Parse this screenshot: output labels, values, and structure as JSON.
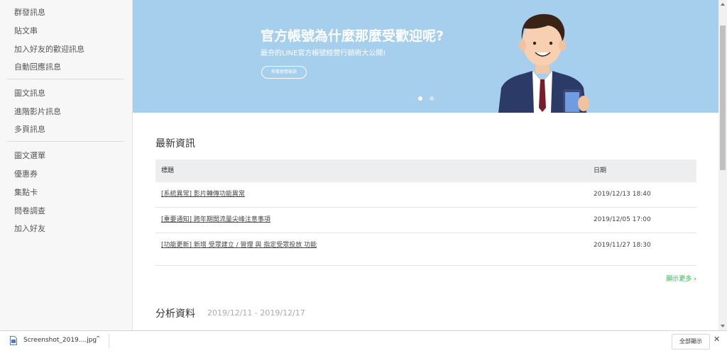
{
  "sidebar": {
    "group1": [
      "群發訊息",
      "貼文串",
      "加入好友的歡迎訊息",
      "自動回應訊息"
    ],
    "group2": [
      "圖文訊息",
      "進階影片訊息",
      "多頁訊息"
    ],
    "group3": [
      "圖文選單",
      "優惠券",
      "集點卡",
      "問卷調查",
      "加入好友"
    ]
  },
  "banner": {
    "title": "官方帳號為什麼那麼受歡迎呢?",
    "subtitle": "最夯的LINE官方帳號經營行銷術大公開!",
    "button_label": "來看經營秘訣",
    "active_dot_color": "#ffffff",
    "dot_color": "#cfe4f4"
  },
  "news": {
    "title": "最新資訊",
    "col_title": "標題",
    "col_date": "日期",
    "rows": [
      {
        "title": "[系統異常] 影片轉傳功能異常",
        "date": "2019/12/13 18:40"
      },
      {
        "title": "[重要通知] 跨年期間流量尖峰注意事項",
        "date": "2019/12/05 17:00"
      },
      {
        "title": "[功能更新] 新增 受眾建立 / 管理 與 指定受眾投放 功能",
        "date": "2019/11/27 18:30"
      }
    ],
    "more_label": "顯示更多",
    "more_color": "#2bbc4e"
  },
  "analysis": {
    "title": "分析資料",
    "range": "2019/12/11 - 2019/12/17"
  },
  "downloads": {
    "file_name": "Screenshot_2019....jpg",
    "show_all": "全部顯示"
  }
}
